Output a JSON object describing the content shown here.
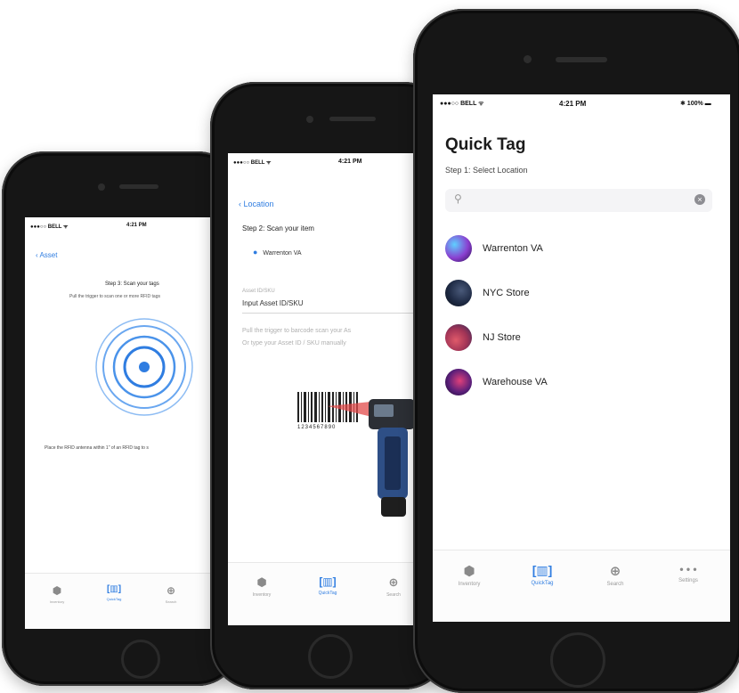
{
  "phone1": {
    "status": {
      "carrier": "●●●○○ BELL ᯤ",
      "time": "4:21 PM"
    },
    "back_label": "‹ Asset",
    "step_title": "Step 3: Scan your tags",
    "instruction": "Pull the trigger to scan one or more RFID tags",
    "footer_note": "Place the RFID antenna within 1\" of an RFID tag to s",
    "tabs": [
      {
        "icon": "⬢",
        "label": "Inventory"
      },
      {
        "icon": "[▥]",
        "label": "QuickTag"
      },
      {
        "icon": "⊕",
        "label": "Search"
      }
    ]
  },
  "phone2": {
    "status": {
      "carrier": "●●●○○ BELL ᯤ",
      "time": "4:21 PM"
    },
    "back_label": "‹ Location",
    "step_title": "Step 2: Scan your item",
    "location_chip": "Warrenton VA",
    "field_label": "Asset ID/SKU",
    "field_value": "Input Asset ID/SKU",
    "hint_line1": "Pull the trigger to barcode scan your As",
    "hint_line2": "Or type your Asset ID / SKU manually",
    "barcode_digits": "1234567890",
    "tabs": [
      {
        "icon": "⬢",
        "label": "Inventory"
      },
      {
        "icon": "[▥]",
        "label": "QuickTag"
      },
      {
        "icon": "⊕",
        "label": "Search"
      }
    ]
  },
  "phone3": {
    "status": {
      "carrier": "●●●○○ BELL ᯤ",
      "time": "4:21 PM",
      "battery": "✱ 100% ▬"
    },
    "title": "Quick Tag",
    "step_title": "Step 1: Select Location",
    "search_placeholder": "",
    "locations": [
      {
        "name": "Warrenton VA",
        "color": "#8a3fd0"
      },
      {
        "name": "NYC Store",
        "color": "#1e2a44"
      },
      {
        "name": "NJ Store",
        "color": "#a23456"
      },
      {
        "name": "Warehouse VA",
        "color": "#5a1f7a"
      }
    ],
    "tabs": [
      {
        "icon": "⬢",
        "label": "Inventory"
      },
      {
        "icon": "[▥]",
        "label": "QuickTag"
      },
      {
        "icon": "⊕",
        "label": "Search"
      },
      {
        "icon": "• • •",
        "label": "Settings"
      }
    ]
  },
  "colors": {
    "accent": "#2f7de1",
    "frame": "#161616"
  }
}
